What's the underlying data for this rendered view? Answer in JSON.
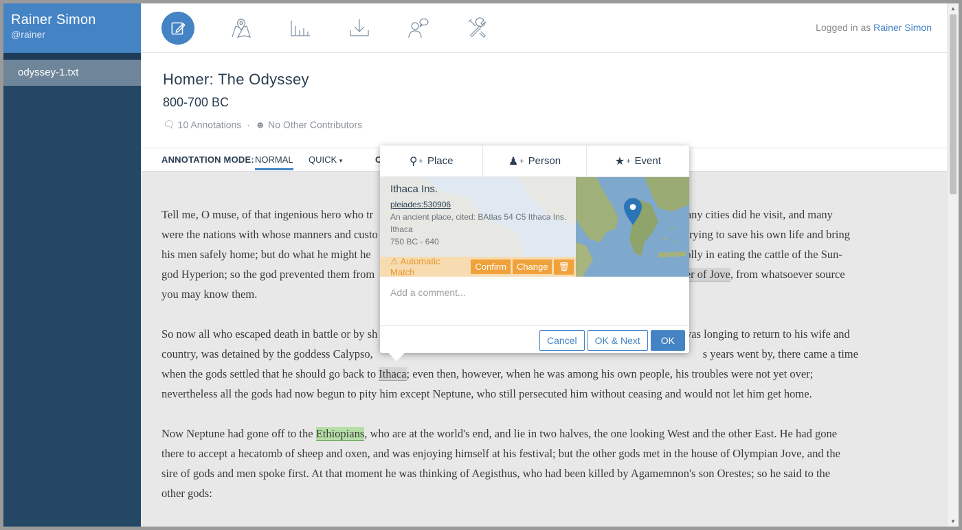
{
  "user": {
    "name": "Rainer Simon",
    "handle": "@rainer"
  },
  "sidebar": {
    "file": "odyssey-1.txt"
  },
  "header": {
    "login_prefix": "Logged in as",
    "login_user": "Rainer Simon",
    "icons": [
      "edit-icon",
      "map-icon",
      "stats-icon",
      "download-icon",
      "share-icon",
      "settings-icon"
    ]
  },
  "doc": {
    "title": "Homer: The Odyssey",
    "date": "800-700 BC",
    "annotations": "10 Annotations",
    "contributors": "No Other Contributors"
  },
  "modebar": {
    "label": "ANNOTATION MODE:",
    "normal": "NORMAL",
    "quick": "QUICK",
    "partial": "C"
  },
  "text": {
    "p1a": "Tell me, O muse, of that ingenious hero who tr",
    "p1b": "Many cities did he visit, and many",
    "p1c": "were the nations with whose manners and custo",
    "p1d": "rying to save his own life and bring",
    "p1e": "his men safely home; but do what he might he",
    "p1f": "folly in eating the cattle of the Sun-",
    "p1g": "god Hyperion; so the god prevented them from",
    "p1h_ann": "ter of Jove",
    "p1i": ", from whatsoever source",
    "p1j": "you may know them.",
    "p2a": "So now all who escaped death in battle or by sh",
    "p2b": "was longing to return to his wife and",
    "p2c": "country, was detained by the goddess Calypso,",
    "p2d": "s years went by, there came a time",
    "p2e": "when the gods settled that he should go back to ",
    "p2_ann": "Ithaca",
    "p2f": "; even then, however, when he was among his own people, his troubles were not yet over;",
    "p2g": "nevertheless all the gods had now begun to pity him except Neptune, who still persecuted him without ceasing and would not let him get home.",
    "p3a": "Now Neptune had gone off to the ",
    "p3_ann": "Ethiopians",
    "p3b": ", who are at the world's end, and lie in two halves, the one looking West and the other East. He had gone",
    "p3c": "there to accept a hecatomb of sheep and oxen, and was enjoying himself at his festival; but the other gods met in the house of Olympian Jove, and the",
    "p3d": "sire of gods and men spoke first. At that moment he was thinking of Aegisthus, who had been killed by Agamemnon's son Orestes; so he said to the",
    "p3e": "other gods:"
  },
  "popup": {
    "tabs": {
      "place": "Place",
      "person": "Person",
      "event": "Event"
    },
    "place_name": "Ithaca Ins.",
    "place_uri": "pleiades:530906",
    "place_desc": "An ancient place, cited: BAtlas 54 C5 Ithaca Ins.",
    "place_alt": "Ithaca",
    "place_dates": "750 BC - 640",
    "match_label": "Automatic Match",
    "confirm": "Confirm",
    "change": "Change",
    "comment_placeholder": "Add a comment...",
    "cancel": "Cancel",
    "ok_next": "OK & Next",
    "ok": "OK"
  }
}
